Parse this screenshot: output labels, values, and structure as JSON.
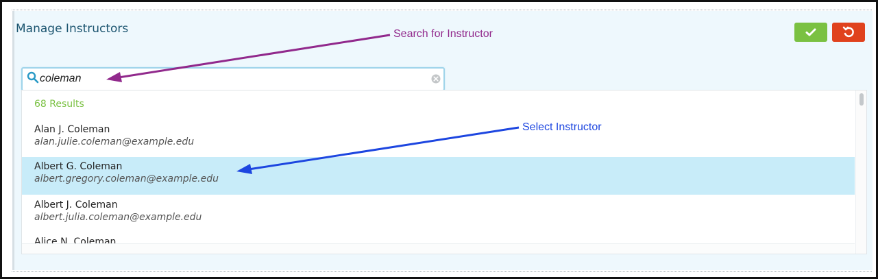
{
  "panel": {
    "title": "Manage Instructors",
    "save_icon": "checkmark-icon",
    "cancel_icon": "undo-icon",
    "colors": {
      "save": "#7ac142",
      "cancel": "#e0421d",
      "selected_row": "#c8ecf9",
      "results_count": "#7ac142"
    }
  },
  "search": {
    "icon": "search-icon",
    "value": "coleman",
    "clear_icon": "clear-icon"
  },
  "results": {
    "count_label": "68 Results",
    "items": [
      {
        "name": "Alan J. Coleman",
        "email": "alan.julie.coleman@example.edu",
        "selected": false
      },
      {
        "name": "Albert G. Coleman",
        "email": "albert.gregory.coleman@example.edu",
        "selected": true
      },
      {
        "name": "Albert J. Coleman",
        "email": "albert.julia.coleman@example.edu",
        "selected": false
      },
      {
        "name": "Alice N. Coleman",
        "email": "",
        "selected": false
      }
    ]
  },
  "annotations": {
    "search_label": "Search for Instructor",
    "search_color": "#91298c",
    "select_label": "Select Instructor",
    "select_color": "#1d46e0"
  }
}
